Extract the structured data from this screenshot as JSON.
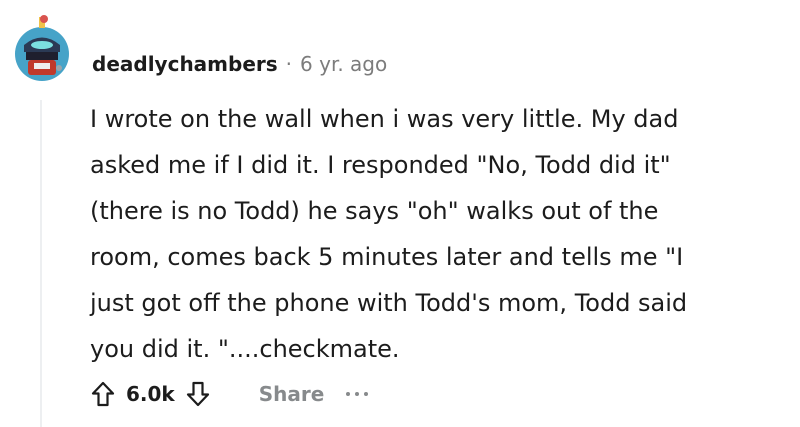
{
  "comment": {
    "author": "deadlychambers",
    "separator": "·",
    "age": "6 yr. ago",
    "lines": [
      "I wrote on the wall when i was very little. My dad",
      "asked me if I did it. I responded \"No, Todd did it\"",
      "(there is no Todd) he says \"oh\" walks out of the",
      "room, comes back 5 minutes later and tells me \"I",
      "just got off the phone with Todd's mom, Todd said",
      "you did it. \"....checkmate."
    ]
  },
  "actions": {
    "upvote_icon": "upvote-arrow-icon",
    "score": "6.0k",
    "downvote_icon": "downvote-arrow-icon",
    "share_label": "Share",
    "more_icon": "more-options-icon"
  },
  "colors": {
    "text": "#1c1c1c",
    "muted": "#7c7c7c",
    "action_gray": "#878a8c",
    "thread_line": "#edeff1",
    "avatar_bg": "#46a3c8"
  }
}
